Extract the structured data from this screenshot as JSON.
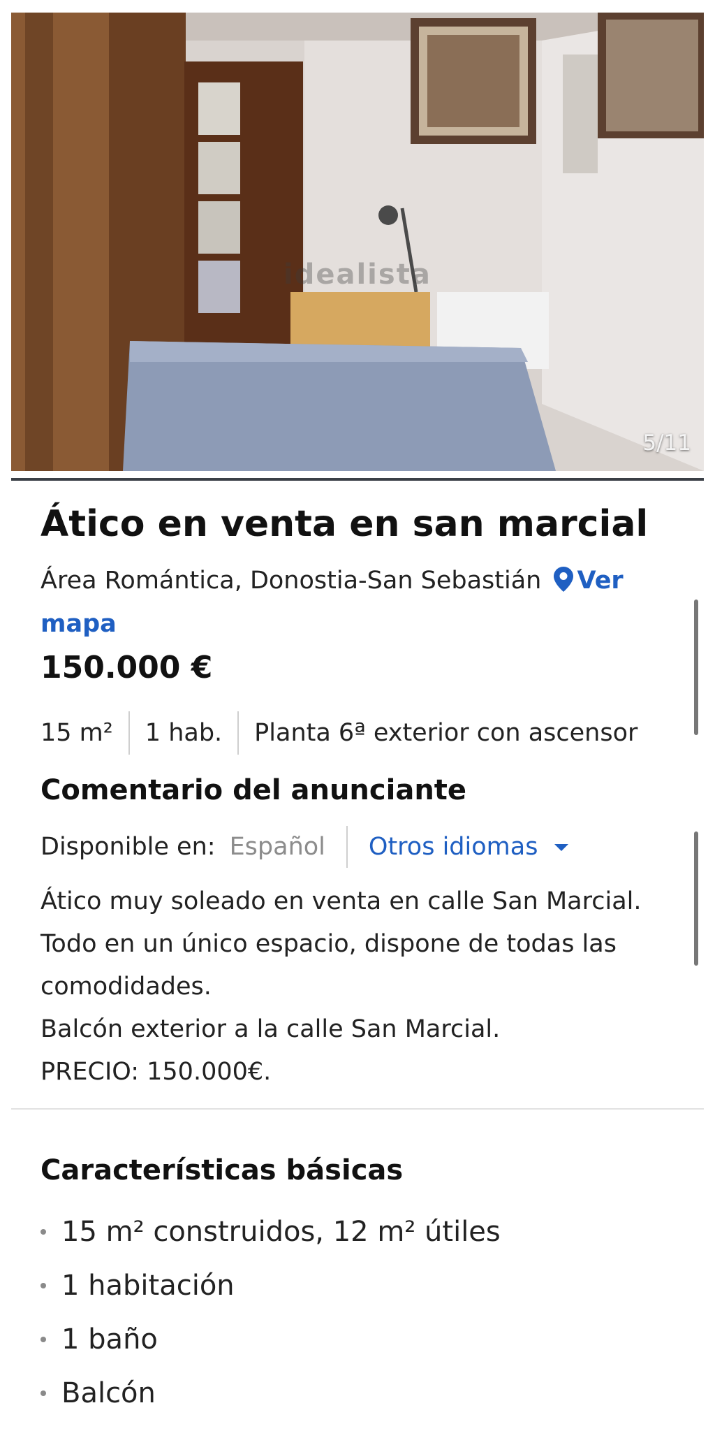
{
  "photo": {
    "counter": "5/11",
    "watermark": "idealista",
    "alt": "Dormitorio con cama, mesa plegable y lámpara"
  },
  "listing": {
    "title": "Ático en venta en san marcial",
    "location": "Área Romántica, Donostia-San Sebastián",
    "map_link": "Ver mapa",
    "price": "150.000 €",
    "features": [
      "15 m²",
      "1 hab.",
      "Planta 6ª exterior con ascensor"
    ]
  },
  "comment": {
    "heading": "Comentario del anunciante",
    "available_label": "Disponible en:",
    "current_language": "Español",
    "other_languages": "Otros idiomas",
    "lines": [
      "Ático muy soleado en venta en calle San Marcial.",
      "Todo en un único espacio, dispone de todas las",
      "comodidades.",
      "Balcón exterior a la calle San Marcial.",
      "PRECIO: 150.000€."
    ]
  },
  "basics": {
    "heading": "Características básicas",
    "items": [
      "15 m² construidos, 12 m² útiles",
      "1 habitación",
      "1 baño",
      "Balcón"
    ]
  },
  "colors": {
    "link": "#1f5fc2",
    "muted": "#8c8c8c",
    "text": "#111111"
  },
  "icons": {
    "location": "map-pin-icon",
    "dropdown": "caret-down-icon"
  }
}
